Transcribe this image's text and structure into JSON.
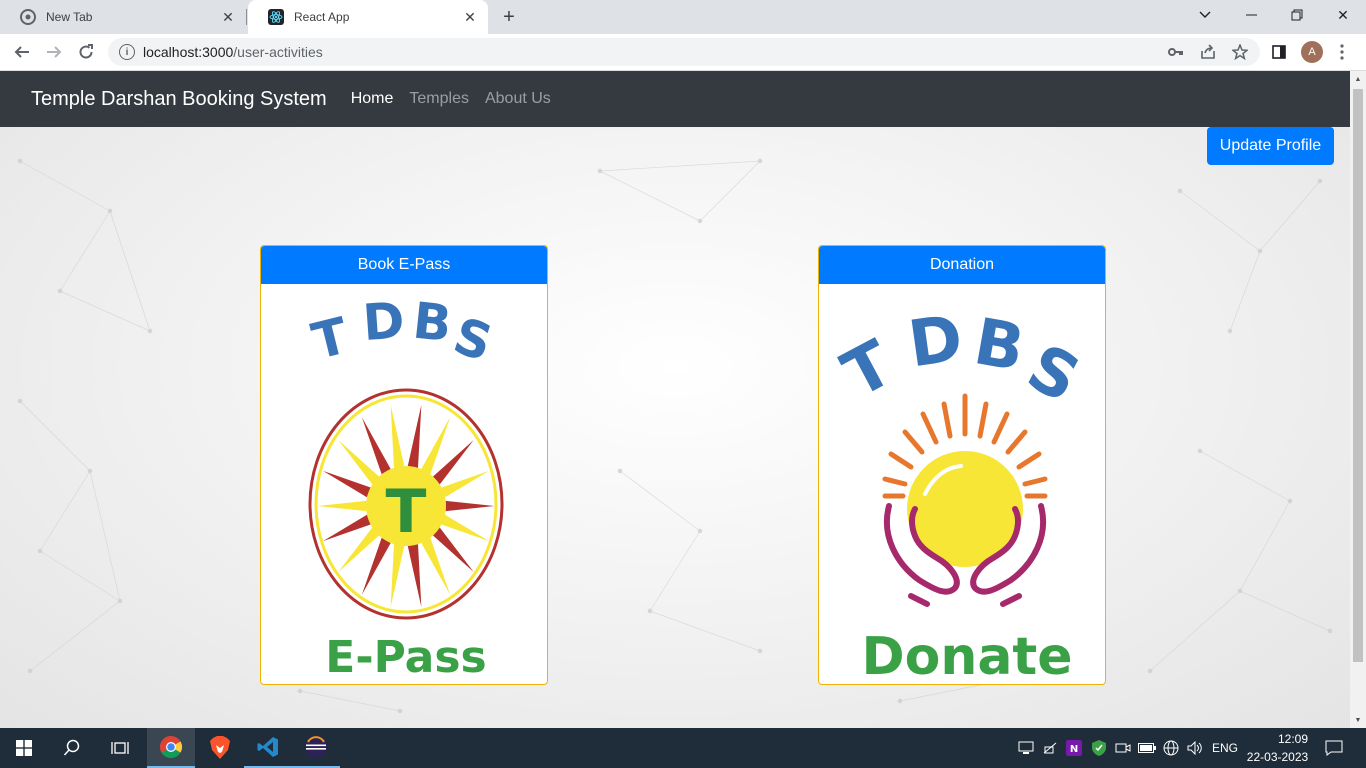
{
  "browser": {
    "tabs": [
      {
        "label": "New Tab",
        "favicon": "chrome-icon"
      },
      {
        "label": "React App",
        "favicon": "react-icon"
      }
    ],
    "url_host": "localhost:3000",
    "url_path": "/user-activities",
    "profile_initial": "A"
  },
  "navbar": {
    "brand": "Temple Darshan Booking System",
    "links": [
      "Home",
      "Temples",
      "About Us"
    ]
  },
  "update_profile_label": "Update Profile",
  "cards": [
    {
      "header": "Book E-Pass",
      "logo_top": "TDBS",
      "logo_letter": "T",
      "logo_bottom": "E-Pass"
    },
    {
      "header": "Donation",
      "logo_top": "TDBS",
      "logo_bottom": "Donate"
    }
  ],
  "taskbar": {
    "lang": "ENG",
    "time": "12:09",
    "date": "22-03-2023"
  },
  "colors": {
    "navbar": "#343a40",
    "primary": "#007bff",
    "card_border": "#f0b400",
    "logo_blue": "#3a74b8",
    "logo_green": "#3aa147",
    "sun_yellow": "#f7e636",
    "sun_red": "#b3312e"
  }
}
